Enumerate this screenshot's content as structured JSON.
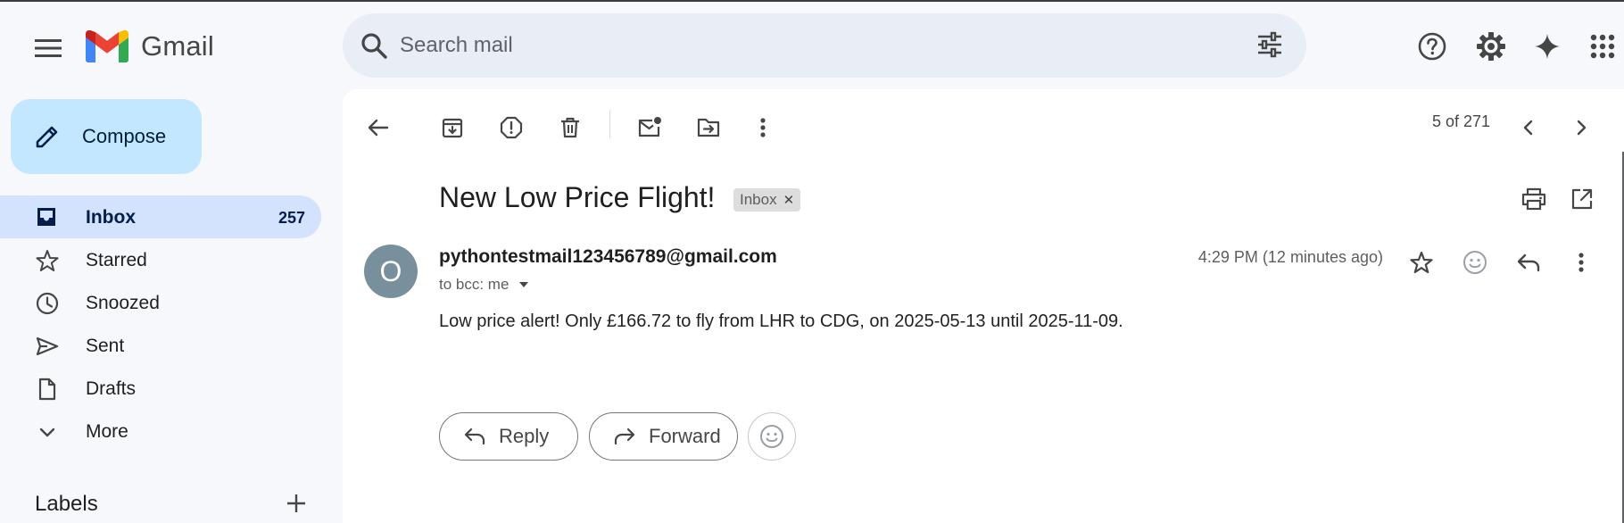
{
  "app": {
    "name": "Gmail"
  },
  "search": {
    "placeholder": "Search mail"
  },
  "header_icons": [
    "help-icon",
    "settings-icon",
    "gemini-icon",
    "apps-icon"
  ],
  "sidebar": {
    "compose_label": "Compose",
    "items": [
      {
        "label": "Inbox",
        "count": "257",
        "icon": "inbox-icon",
        "active": true
      },
      {
        "label": "Starred",
        "count": "",
        "icon": "star-icon",
        "active": false
      },
      {
        "label": "Snoozed",
        "count": "",
        "icon": "clock-icon",
        "active": false
      },
      {
        "label": "Sent",
        "count": "",
        "icon": "send-icon",
        "active": false
      },
      {
        "label": "Drafts",
        "count": "",
        "icon": "draft-icon",
        "active": false
      },
      {
        "label": "More",
        "count": "",
        "icon": "chevron-down-icon",
        "active": false
      }
    ],
    "labels_title": "Labels"
  },
  "toolbar": {
    "icons": [
      "back-arrow-icon",
      "archive-icon",
      "report-spam-icon",
      "delete-icon",
      "mark-unread-icon",
      "move-to-icon",
      "more-vert-icon"
    ],
    "pager": "5 of 271"
  },
  "email": {
    "subject": "New Low Price Flight!",
    "label_chip": "Inbox",
    "sender_initial": "O",
    "sender": "pythontestmail123456789@gmail.com",
    "recipients": "to bcc: me",
    "time": "4:29 PM (12 minutes ago)",
    "body": "Low price alert! Only £166.72 to fly from LHR to CDG, on 2025-05-13 until 2025-11-09."
  },
  "actions": {
    "reply_label": "Reply",
    "forward_label": "Forward"
  },
  "colors": {
    "background": "#f6f8fc",
    "compose": "#c2e7ff",
    "active_nav": "#d3e3fd",
    "search_bg": "#e9eef6",
    "avatar": "#78909c"
  }
}
